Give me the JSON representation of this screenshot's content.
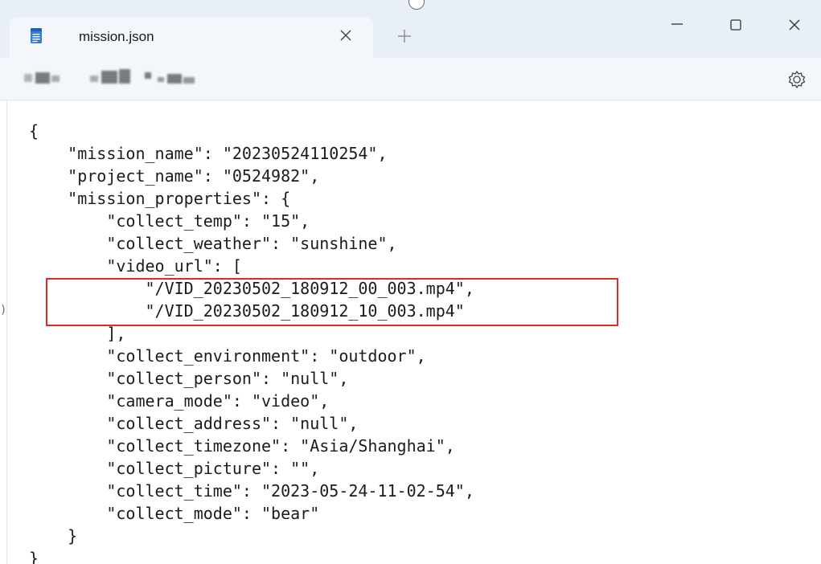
{
  "window": {
    "tab_title": "mission.json",
    "controls": {
      "minimize_icon": "minimize-icon",
      "maximize_icon": "maximize-icon",
      "close_icon": "close-icon"
    }
  },
  "tab": {
    "app_icon": "notepad-icon",
    "close_icon": "close-icon",
    "new_tab_icon": "plus-icon"
  },
  "menubar": {
    "settings_icon": "gear-icon"
  },
  "editor": {
    "highlight_color": "#e02b20",
    "lines": [
      "{",
      "    \"mission_name\": \"20230524110254\",",
      "    \"project_name\": \"0524982\",",
      "    \"mission_properties\": {",
      "        \"collect_temp\": \"15\",",
      "        \"collect_weather\": \"sunshine\",",
      "        \"video_url\": [",
      "            \"/VID_20230502_180912_00_003.mp4\",",
      "            \"/VID_20230502_180912_10_003.mp4\"",
      "        ],",
      "        \"collect_environment\": \"outdoor\",",
      "        \"collect_person\": \"null\",",
      "        \"camera_mode\": \"video\",",
      "        \"collect_address\": \"null\",",
      "        \"collect_timezone\": \"Asia/Shanghai\",",
      "        \"collect_picture\": \"\",",
      "        \"collect_time\": \"2023-05-24-11-02-54\",",
      "        \"collect_mode\": \"bear\"",
      "    }",
      "}"
    ]
  }
}
